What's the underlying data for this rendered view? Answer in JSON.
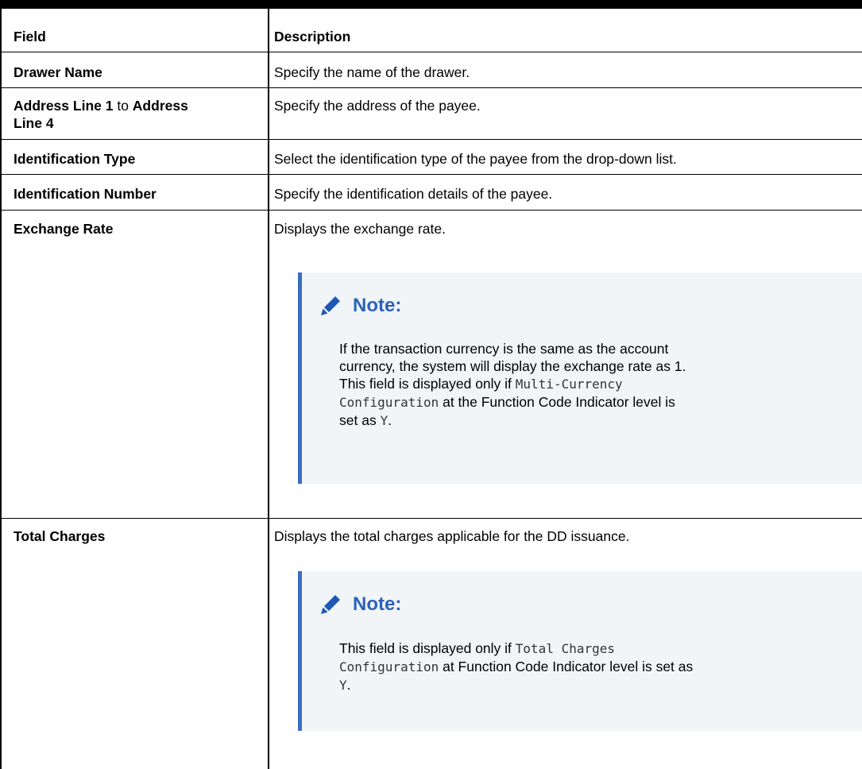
{
  "table": {
    "header": {
      "field": "Field",
      "description": "Description"
    },
    "rows": [
      {
        "field": "Drawer Name",
        "description": "Specify the name of the drawer."
      },
      {
        "field_part1": "Address Line 1",
        "field_part2": " to ",
        "field_part3": "Address",
        "field_line2": "Line 4",
        "description": "Specify the address of the payee."
      },
      {
        "field": "Identification Type",
        "description": "Select the identification type of the payee from the drop-down list."
      },
      {
        "field": "Identification Number",
        "description": "Specify the identification details of the payee."
      },
      {
        "field": "Exchange Rate",
        "description": "Displays the exchange rate.",
        "note": {
          "title": "Note:",
          "line1": "If the transaction currency is the same as the account",
          "line2": "currency, the system will display the exchange rate as 1.",
          "line3_a": "This field is displayed only if ",
          "line3_code": "Multi-Currency",
          "line4_code": "Configuration",
          "line4_b": " at the Function Code Indicator level is",
          "line5_a": "set as ",
          "line5_code": "Y",
          "line5_b": "."
        }
      },
      {
        "field": "Total Charges",
        "description": "Displays the total charges applicable for the DD issuance.",
        "note": {
          "title": "Note:",
          "line1_a": "This field is displayed only if ",
          "line1_code": "Total Charges",
          "line2_code": "Configuration",
          "line2_b": " at Function Code Indicator level is set as",
          "line3_code": "Y",
          "line3_b": "."
        }
      }
    ]
  },
  "icons": {
    "note_icon": "pencil-icon"
  },
  "colors": {
    "note_accent": "#3b6cc3",
    "note_title": "#2a62b7",
    "note_background": "#f1f5f8"
  }
}
